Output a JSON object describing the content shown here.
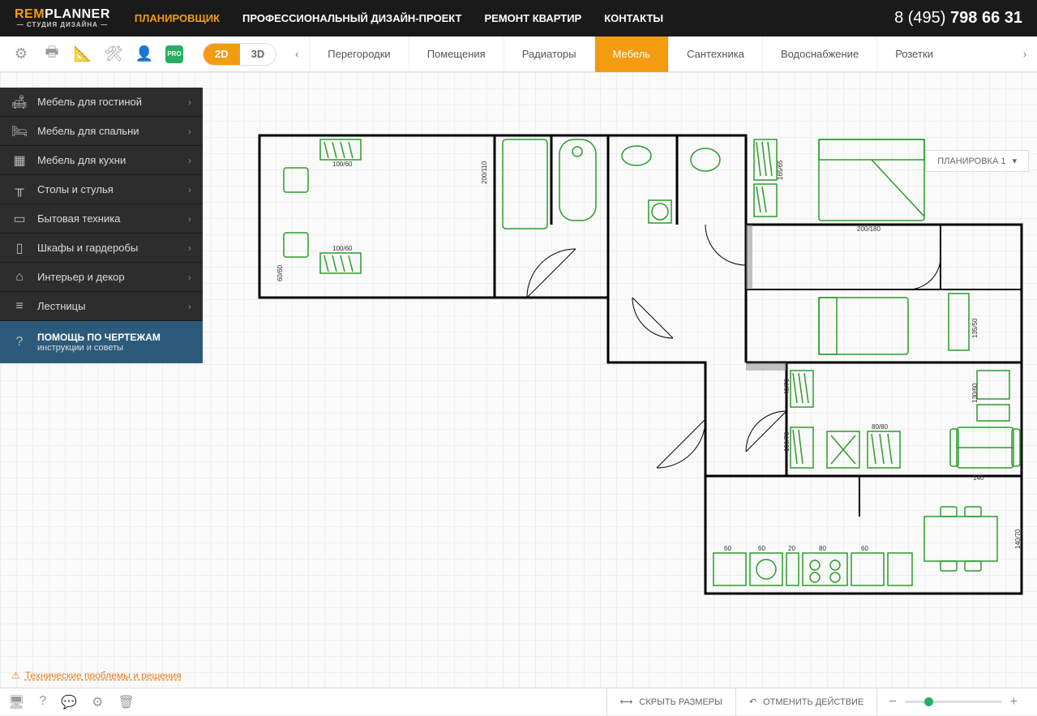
{
  "logo": {
    "rem": "REM",
    "planner": "PLANNER",
    "sub": "— СТУДИЯ ДИЗАЙНА —"
  },
  "nav": {
    "items": [
      {
        "label": "ПЛАНИРОВЩИК",
        "active": true
      },
      {
        "label": "ПРОФЕССИОНАЛЬНЫЙ ДИЗАЙН-ПРОЕКТ",
        "active": false
      },
      {
        "label": "РЕМОНТ КВАРТИР",
        "active": false
      },
      {
        "label": "КОНТАКТЫ",
        "active": false
      }
    ]
  },
  "phone": {
    "prefix": "8 (495) ",
    "number": "798 66 31"
  },
  "view": {
    "d2": "2D",
    "d3": "3D"
  },
  "pro": "PRO",
  "tabs": {
    "items": [
      {
        "label": "Перегородки"
      },
      {
        "label": "Помещения"
      },
      {
        "label": "Радиаторы"
      },
      {
        "label": "Мебель",
        "active": true
      },
      {
        "label": "Сантехника"
      },
      {
        "label": "Водоснабжение"
      },
      {
        "label": "Розетки"
      }
    ]
  },
  "plan_selector": "ПЛАНИРОВКА 1",
  "sidebar": {
    "items": [
      {
        "label": "Мебель для гостиной",
        "icon": "sofa"
      },
      {
        "label": "Мебель для спальни",
        "icon": "bed"
      },
      {
        "label": "Мебель для кухни",
        "icon": "cabinet"
      },
      {
        "label": "Столы и стулья",
        "icon": "table"
      },
      {
        "label": "Бытовая техника",
        "icon": "tv"
      },
      {
        "label": "Шкафы и гардеробы",
        "icon": "wardrobe"
      },
      {
        "label": "Интерьер и декор",
        "icon": "home"
      },
      {
        "label": "Лестницы",
        "icon": "stairs"
      }
    ],
    "help": {
      "title": "ПОМОЩЬ ПО ЧЕРТЕЖАМ",
      "sub": "инструкции и советы"
    }
  },
  "bottom_link": "Технические проблемы и решения",
  "footer": {
    "hide_dims": "СКРЫТЬ РАЗМЕРЫ",
    "undo": "ОТМЕНИТЬ ДЕЙСТВИЕ"
  },
  "dimensions": {
    "d1": "100/60",
    "d2": "200/110",
    "d3": "100/60",
    "d4": "60/60",
    "d5": "165/65",
    "d6": "200/180",
    "d7": "40/70",
    "d8": "100/70",
    "d9": "135/50",
    "d10": "130/60",
    "d11": "80/80",
    "d12": "140",
    "d13": "60",
    "d14": "20",
    "d15": "80",
    "d16": "140/70"
  }
}
